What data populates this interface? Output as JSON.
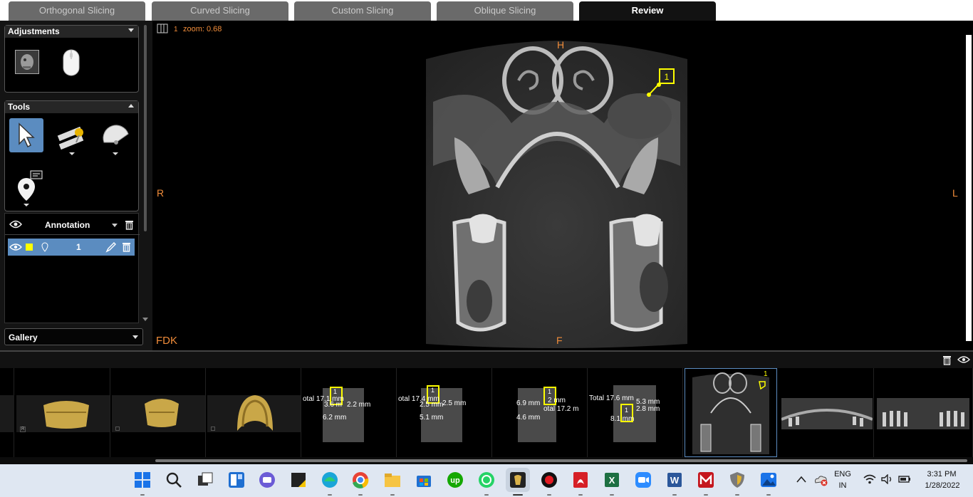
{
  "tabs": [
    {
      "label": "Orthogonal Slicing",
      "active": false
    },
    {
      "label": "Curved Slicing",
      "active": false
    },
    {
      "label": "Custom Slicing",
      "active": false
    },
    {
      "label": "Oblique Slicing",
      "active": false
    },
    {
      "label": "Review",
      "active": true
    }
  ],
  "left_panel": {
    "adjustments_title": "Adjustments",
    "tools_title": "Tools",
    "annotation_header": "Annotation",
    "annotation_row_value": "1",
    "gallery_label": "Gallery"
  },
  "viewer": {
    "slice_number": "1",
    "zoom_text": "zoom: 0.68",
    "orient_top": "H",
    "orient_bottom": "F",
    "orient_left": "R",
    "orient_right": "L",
    "fdk_label": "FDK",
    "annotation_marker": "1"
  },
  "thumbnails": [
    {
      "kind": "render3d",
      "corner_mark": "R"
    },
    {
      "kind": "render3d"
    },
    {
      "kind": "render3d"
    },
    {
      "kind": "measure",
      "texts": [
        "otal 17.1 mm",
        "3.6 m",
        "2.2 mm",
        "6.2 mm",
        "1"
      ]
    },
    {
      "kind": "measure",
      "texts": [
        "otal 17.4 mm",
        "2.5 mm",
        "2.5 mm",
        "5.1 mm",
        "1"
      ]
    },
    {
      "kind": "measure",
      "texts": [
        "6.9 mm",
        "2 mm",
        "otal 17.2 m",
        "4.6 mm",
        "1"
      ]
    },
    {
      "kind": "measure",
      "texts": [
        "Total 17.6 mm",
        "5.3 mm",
        "2.8 mm",
        "8.1 mm",
        "1"
      ]
    },
    {
      "kind": "axial",
      "selected": true,
      "marker": "1"
    },
    {
      "kind": "panoramic"
    },
    {
      "kind": "panoramic"
    }
  ],
  "taskbar": {
    "apps": [
      "windows-start-icon",
      "search-icon",
      "task-view-icon",
      "widgets-icon",
      "teams-chat-icon",
      "sticky-notes-icon",
      "edge-icon",
      "chrome-icon",
      "file-explorer-icon",
      "microsoft-store-icon",
      "upwork-icon",
      "whatsapp-icon",
      "dental-viewer-icon",
      "recorder-icon",
      "acrobat-icon",
      "excel-icon",
      "zoom-icon",
      "word-icon",
      "mega-icon",
      "vpn-shield-icon",
      "photos-icon"
    ],
    "lang_top": "ENG",
    "lang_bottom": "IN",
    "time": "3:31 PM",
    "date": "1/28/2022"
  }
}
